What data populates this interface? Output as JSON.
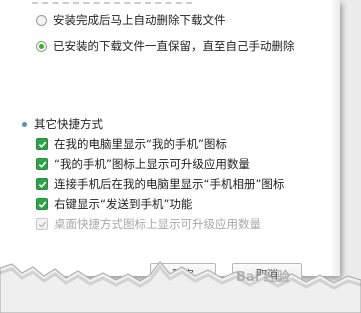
{
  "download_settings": {
    "truncated_top_text": "",
    "option_delete": "安装完成后马上自动删除下载文件",
    "option_keep": "已安装的下载文件一直保留，直至自己手动删除"
  },
  "shortcuts": {
    "section_title": "其它快捷方式",
    "items": [
      {
        "label": "在我的电脑里显示“我的手机”图标",
        "checked": true,
        "enabled": true
      },
      {
        "label": "“我的手机”图标上显示可升级应用数量",
        "checked": true,
        "enabled": true
      },
      {
        "label": "连接手机后在我的电脑里显示“手机相册”图标",
        "checked": true,
        "enabled": true
      },
      {
        "label": "右键显示“发送到手机”功能",
        "checked": true,
        "enabled": true
      },
      {
        "label": "桌面快捷方式图标上显示可升级应用数量",
        "checked": true,
        "enabled": false
      }
    ]
  },
  "footer": {
    "ok_label": "确定",
    "cancel_label": "取消"
  },
  "watermark": "Bai 经验",
  "colors": {
    "check_green": "#2fa34a",
    "radio_green": "#3fae2a",
    "bullet_blue": "#5f8fb0"
  }
}
